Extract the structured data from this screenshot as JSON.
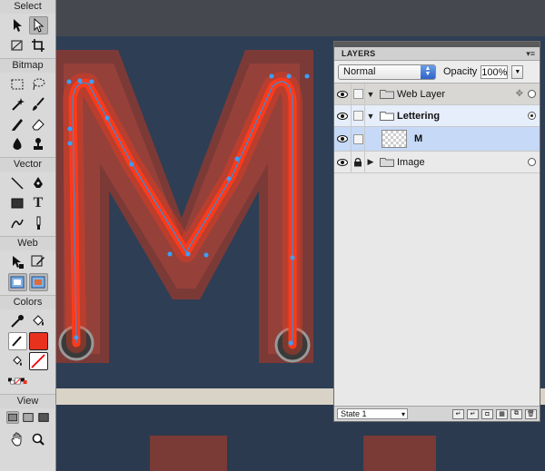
{
  "tools": {
    "sections": {
      "select": "Select",
      "bitmap": "Bitmap",
      "vector": "Vector",
      "web": "Web",
      "colors": "Colors",
      "view": "View"
    },
    "text_tool_glyph": "T"
  },
  "colors": {
    "stroke_fill": "#e8321e",
    "neon": "#ff3a1a",
    "path": "#2f8fe0",
    "panel_bg": "#e8e8e8",
    "selected_row": "#c6d9f6"
  },
  "layers_panel": {
    "tab": "LAYERS",
    "blend_mode": "Normal",
    "opacity_label": "Opacity",
    "opacity_value": "100%",
    "rows": [
      {
        "name": "Web Layer"
      },
      {
        "name": "Lettering"
      },
      {
        "name": "M"
      },
      {
        "name": "Image"
      }
    ],
    "state": "State 1"
  }
}
